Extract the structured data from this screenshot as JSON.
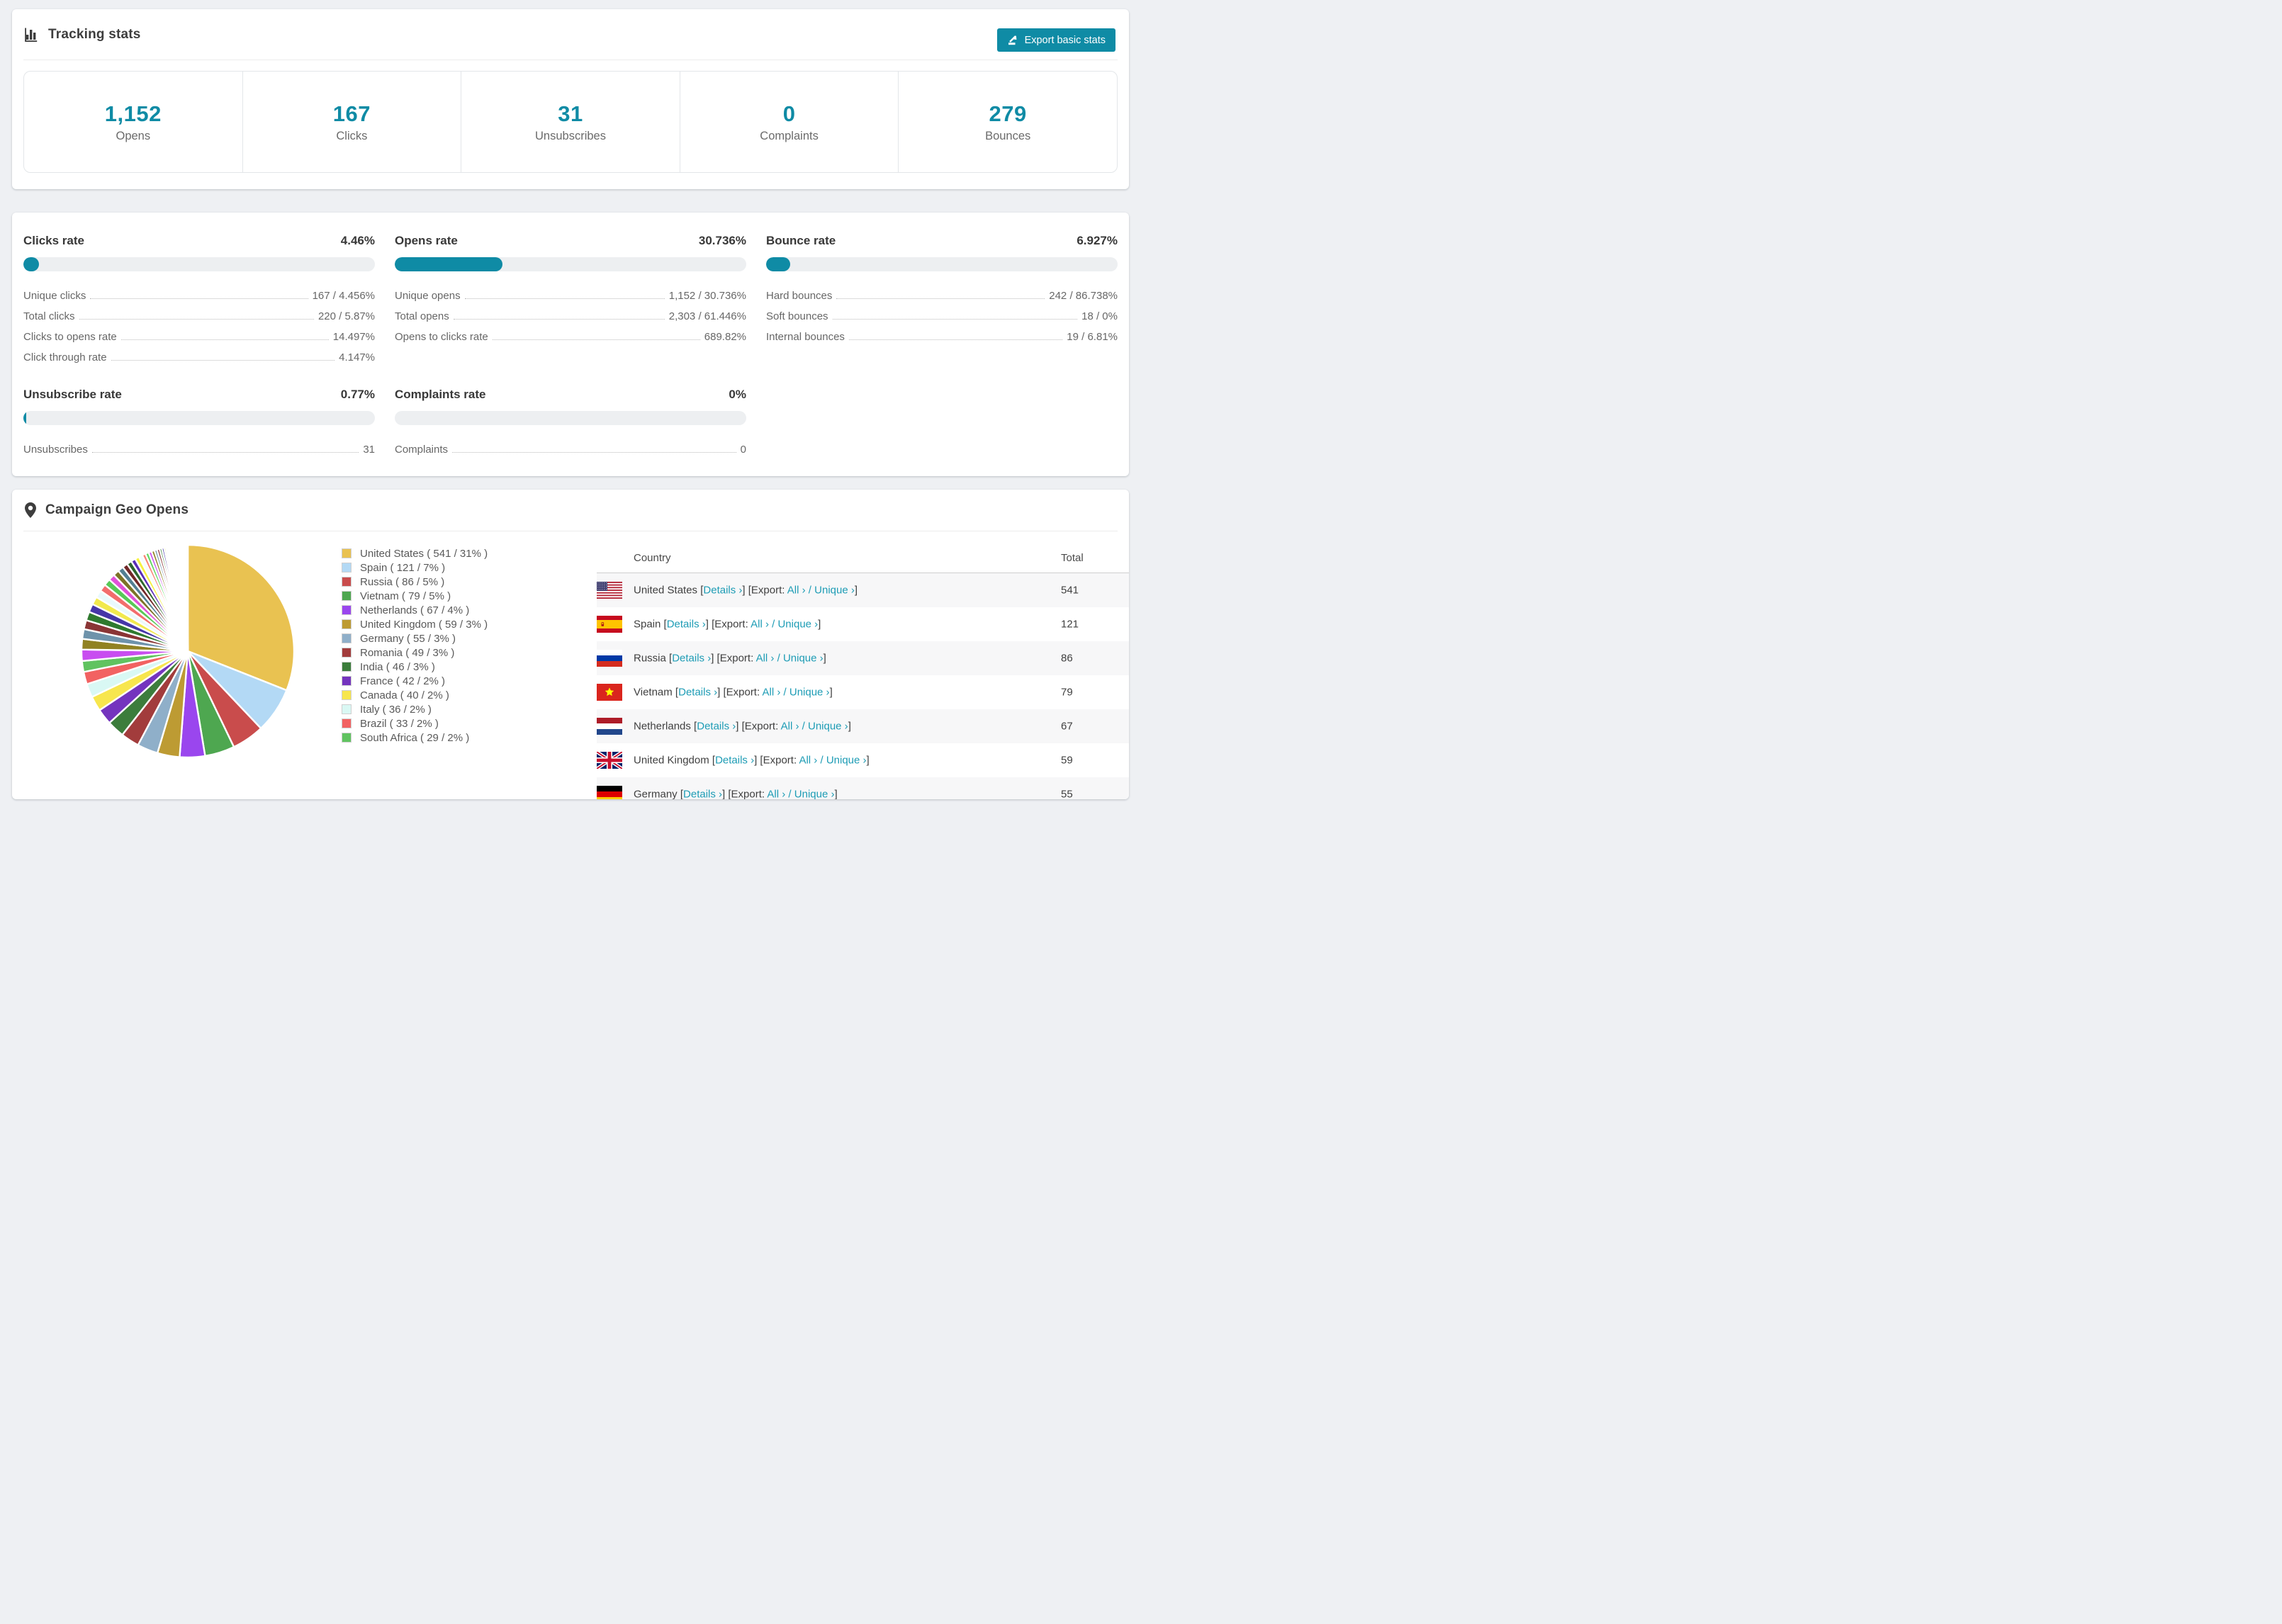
{
  "theme": {
    "accent": "#0f8ba5",
    "link_color": "#1d9cb5",
    "page_bg": "#eef0f3",
    "stripe_bg": "#f7f7f8"
  },
  "tracking": {
    "title": "Tracking stats",
    "export_button": "Export basic stats",
    "stats": [
      {
        "value": "1,152",
        "label": "Opens"
      },
      {
        "value": "167",
        "label": "Clicks"
      },
      {
        "value": "31",
        "label": "Unsubscribes"
      },
      {
        "value": "0",
        "label": "Complaints"
      },
      {
        "value": "279",
        "label": "Bounces"
      }
    ]
  },
  "rates": {
    "blocks": [
      {
        "id": "clicks",
        "title": "Clicks rate",
        "value": "4.46%",
        "pct": 4.46,
        "rows": [
          {
            "label": "Unique clicks",
            "value": "167 / 4.456%"
          },
          {
            "label": "Total clicks",
            "value": "220 / 5.87%"
          },
          {
            "label": "Clicks to opens rate",
            "value": "14.497%"
          },
          {
            "label": "Click through rate",
            "value": "4.147%"
          }
        ]
      },
      {
        "id": "opens",
        "title": "Opens rate",
        "value": "30.736%",
        "pct": 30.736,
        "rows": [
          {
            "label": "Unique opens",
            "value": "1,152 / 30.736%"
          },
          {
            "label": "Total opens",
            "value": "2,303 / 61.446%"
          },
          {
            "label": "Opens to clicks rate",
            "value": "689.82%"
          }
        ]
      },
      {
        "id": "bounce",
        "title": "Bounce rate",
        "value": "6.927%",
        "pct": 6.927,
        "rows": [
          {
            "label": "Hard bounces",
            "value": "242 / 86.738%"
          },
          {
            "label": "Soft bounces",
            "value": "18 / 0%"
          },
          {
            "label": "Internal bounces",
            "value": "19 / 6.81%"
          }
        ]
      },
      {
        "id": "unsubscribe",
        "title": "Unsubscribe rate",
        "value": "0.77%",
        "pct": 0.77,
        "rows": [
          {
            "label": "Unsubscribes",
            "value": "31"
          }
        ]
      },
      {
        "id": "complaints",
        "title": "Complaints rate",
        "value": "0%",
        "pct": 0,
        "rows": [
          {
            "label": "Complaints",
            "value": "0"
          }
        ]
      }
    ]
  },
  "geo": {
    "title": "Campaign Geo Opens",
    "chart_data": {
      "type": "pie",
      "title": "Campaign Geo Opens",
      "labels": [
        "United States",
        "Spain",
        "Russia",
        "Vietnam",
        "Netherlands",
        "United Kingdom",
        "Germany",
        "Romania",
        "India",
        "France",
        "Canada",
        "Italy",
        "Brazil",
        "South Africa"
      ],
      "values": [
        541,
        121,
        86,
        79,
        67,
        59,
        55,
        49,
        46,
        42,
        40,
        36,
        33,
        29
      ],
      "percents": [
        "31%",
        "7%",
        "5%",
        "5%",
        "4%",
        "3%",
        "3%",
        "3%",
        "3%",
        "2%",
        "2%",
        "2%",
        "2%",
        "2%"
      ],
      "colors": [
        "#e9c251",
        "#b3d9f5",
        "#c94c4c",
        "#4ea750",
        "#9a46ee",
        "#bd9b33",
        "#8fafc9",
        "#a23c3c",
        "#3c7d3c",
        "#7434be",
        "#f7e64d",
        "#d9f8f4",
        "#f26262",
        "#60c360"
      ],
      "tail_values": [
        30,
        28,
        26,
        24,
        23,
        22,
        21,
        20,
        19,
        18,
        17,
        16,
        15,
        14,
        13,
        12,
        11,
        10,
        9,
        9,
        8,
        8,
        7,
        7,
        6,
        6,
        5,
        5,
        4,
        4,
        3,
        3,
        3,
        3,
        2,
        2,
        2,
        2,
        2,
        2,
        1,
        1,
        1,
        1,
        1,
        1,
        1,
        1,
        1,
        1,
        1,
        1,
        1,
        1,
        1,
        1,
        1,
        1,
        1,
        1,
        1
      ],
      "tail_colors": [
        "#c84df0",
        "#918222",
        "#6e93ab",
        "#8a3535",
        "#2f7a2f",
        "#4636a8",
        "#f2e94d",
        "#e9f9fc",
        "#f26d6d",
        "#57c957",
        "#e052d8",
        "#7c7226",
        "#527f92",
        "#722828",
        "#2d662d",
        "#5a2db8",
        "#f7f23f",
        "#f2fbff",
        "#fa8072",
        "#62d862"
      ],
      "legend_position": "right"
    },
    "legend_labels": [
      "United States ( 541 / 31% )",
      "Spain ( 121 / 7% )",
      "Russia ( 86 / 5% )",
      "Vietnam ( 79 / 5% )",
      "Netherlands ( 67 / 4% )",
      "United Kingdom ( 59 / 3% )",
      "Germany ( 55 / 3% )",
      "Romania ( 49 / 3% )",
      "India ( 46 / 3% )",
      "France ( 42 / 2% )",
      "Canada ( 40 / 2% )",
      "Italy ( 36 / 2% )",
      "Brazil ( 33 / 2% )",
      "South Africa ( 29 / 2% )"
    ],
    "table": {
      "columns": [
        "Country",
        "Total"
      ],
      "link_labels": {
        "details": "Details ›",
        "open_bracket": " [",
        "close_bracket": "]",
        "export_prefix": "] [Export: ",
        "all": "All ›",
        "separator": " / ",
        "unique": "Unique ›",
        "end_bracket": "]"
      },
      "rows": [
        {
          "country": "United States",
          "flag": "us",
          "total": "541"
        },
        {
          "country": "Spain",
          "flag": "es",
          "total": "121"
        },
        {
          "country": "Russia",
          "flag": "ru",
          "total": "86"
        },
        {
          "country": "Vietnam",
          "flag": "vn",
          "total": "79"
        },
        {
          "country": "Netherlands",
          "flag": "nl",
          "total": "67"
        },
        {
          "country": "United Kingdom",
          "flag": "gb",
          "total": "59"
        },
        {
          "country": "Germany",
          "flag": "de",
          "total": "55"
        }
      ]
    }
  }
}
